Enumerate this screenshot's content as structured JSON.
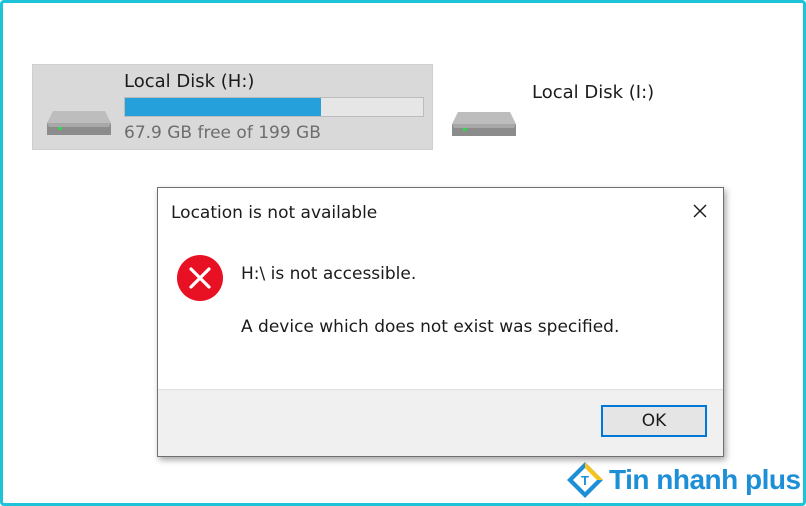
{
  "drives": [
    {
      "name": "Local Disk (H:)",
      "free_text": "67.9 GB free of 199 GB",
      "used_fraction": 0.659,
      "selected": true,
      "icon": "hard-drive-icon"
    },
    {
      "name": "Local Disk (I:)",
      "icon": "hard-drive-icon"
    }
  ],
  "dialog": {
    "title": "Location is not available",
    "message_primary": "H:\\ is not accessible.",
    "message_secondary": "A device which does not exist was specified.",
    "ok_label": "OK",
    "icon": "error-icon",
    "close_icon": "close-icon"
  },
  "brand": {
    "text": "Tin nhanh plus",
    "logo_letter": "T"
  },
  "colors": {
    "frame_border": "#1ec3d8",
    "progress_fill": "#26a0da",
    "error_red": "#e81123",
    "accent_blue": "#0078d7",
    "brand_blue": "#1d8fd6",
    "brand_yellow": "#f5c31c"
  }
}
